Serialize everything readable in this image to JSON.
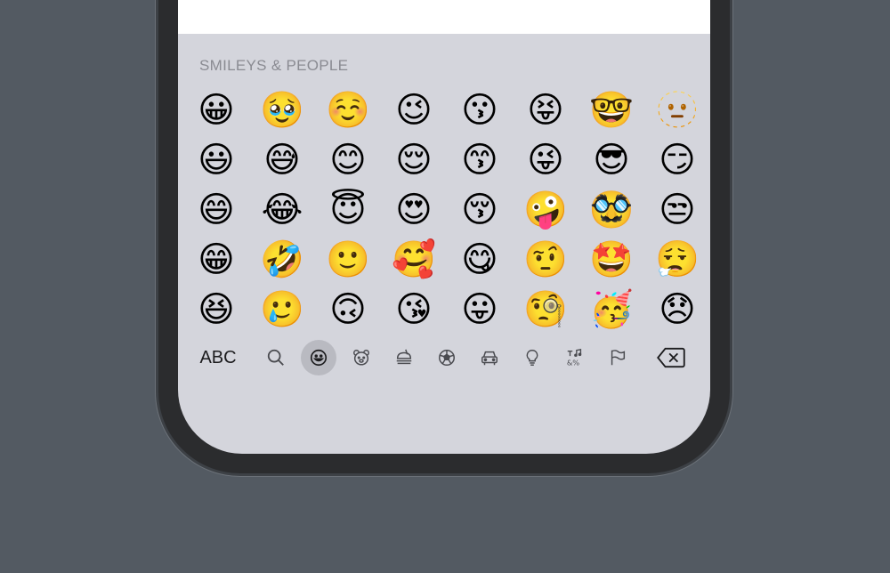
{
  "keyboard": {
    "section_title": "SMILEYS & PEOPLE",
    "emojis": [
      "😀",
      "🥹",
      "☺️",
      "😉",
      "😗",
      "😝",
      "🤓",
      "🫥",
      "😃",
      "😅",
      "😊",
      "😌",
      "😙",
      "😜",
      "😎",
      "😏",
      "😄",
      "😂",
      "😇",
      "😍",
      "😚",
      "🤪",
      "🥸",
      "😒",
      "😁",
      "🤣",
      "🙂",
      "🥰",
      "😋",
      "🤨",
      "🤩",
      "😮‍💨",
      "😆",
      "🥲",
      "🙃",
      "😘",
      "😛",
      "🧐",
      "🥳",
      "😞"
    ],
    "toolbar": {
      "abc_label": "ABC",
      "categories": [
        {
          "name": "search-icon",
          "glyph": "⌕"
        },
        {
          "name": "smiley-icon",
          "glyph": "☺"
        },
        {
          "name": "animal-icon",
          "glyph": "🐻"
        },
        {
          "name": "food-icon",
          "glyph": "🍔"
        },
        {
          "name": "activity-icon",
          "glyph": "⚽"
        },
        {
          "name": "travel-icon",
          "glyph": "🚗"
        },
        {
          "name": "objects-icon",
          "glyph": "💡"
        },
        {
          "name": "symbols-icon",
          "glyph": "♪"
        },
        {
          "name": "flags-icon",
          "glyph": "⚑"
        }
      ],
      "active_category": "smiley-icon"
    }
  }
}
